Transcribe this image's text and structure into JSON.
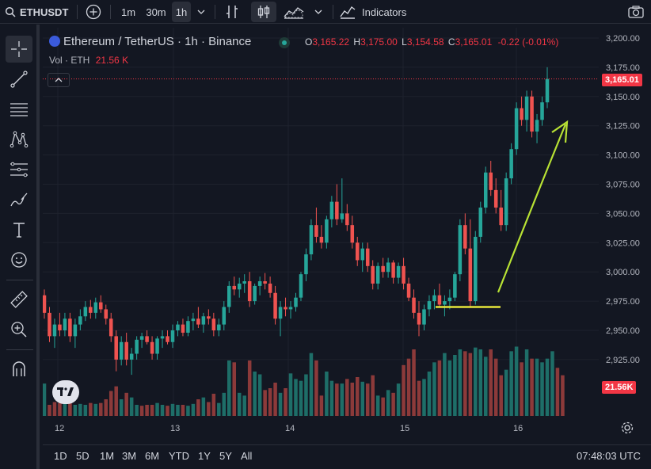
{
  "toolbar": {
    "symbol": "ETHUSDT",
    "intervals": [
      "1m",
      "30m",
      "1h"
    ],
    "active_interval": "1h",
    "indicators_label": "Indicators"
  },
  "legend": {
    "title": "Ethereum / TetherUS · 1h · Binance",
    "o_label": "O",
    "o_value": "3,165.22",
    "h_label": "H",
    "h_value": "3,175.00",
    "l_label": "L",
    "l_value": "3,154.58",
    "c_label": "C",
    "c_value": "3,165.01",
    "change": "-0.22 (-0.01%)",
    "vol_label": "Vol · ETH",
    "vol_value": "21.56 K"
  },
  "price_scale": {
    "ticks": [
      "3,200.00",
      "3,175.00",
      "3,150.00",
      "3,125.00",
      "3,100.00",
      "3,075.00",
      "3,050.00",
      "3,025.00",
      "3,000.00",
      "2,975.00",
      "2,950.00",
      "2,925.00"
    ],
    "last_price_badge": "3,165.01",
    "volume_badge": "21.56K"
  },
  "time_scale": {
    "labels": [
      "12",
      "13",
      "14",
      "15",
      "16"
    ]
  },
  "bottom": {
    "ranges": [
      "1D",
      "5D",
      "1M",
      "3M",
      "6M",
      "YTD",
      "1Y",
      "5Y",
      "All"
    ],
    "clock": "07:48:03 UTC"
  },
  "colors": {
    "up": "#26a69a",
    "down": "#ef5350",
    "up_volume": "#1e6e68",
    "down_volume": "#8c3a3a",
    "background": "#131722",
    "annotation_line": "#e6e63a",
    "annotation_arrow": "#b8e234"
  },
  "chart_data": {
    "type": "candlestick",
    "symbol": "ETHUSDT",
    "ylim": [
      2910,
      3210
    ],
    "candles": [
      [
        2980,
        2985,
        2960,
        2965
      ],
      [
        2965,
        2970,
        2940,
        2945
      ],
      [
        2945,
        2960,
        2935,
        2955
      ],
      [
        2955,
        2965,
        2945,
        2950
      ],
      [
        2950,
        2965,
        2945,
        2960
      ],
      [
        2960,
        2965,
        2940,
        2945
      ],
      [
        2945,
        2960,
        2935,
        2955
      ],
      [
        2955,
        2968,
        2950,
        2962
      ],
      [
        2962,
        2975,
        2958,
        2970
      ],
      [
        2970,
        2976,
        2960,
        2965
      ],
      [
        2965,
        2978,
        2960,
        2974
      ],
      [
        2974,
        2980,
        2965,
        2968
      ],
      [
        2968,
        2972,
        2955,
        2960
      ],
      [
        2960,
        2965,
        2940,
        2945
      ],
      [
        2945,
        2950,
        2915,
        2925
      ],
      [
        2925,
        2945,
        2920,
        2940
      ],
      [
        2940,
        2948,
        2920,
        2925
      ],
      [
        2925,
        2935,
        2912,
        2930
      ],
      [
        2930,
        2945,
        2925,
        2942
      ],
      [
        2942,
        2948,
        2935,
        2945
      ],
      [
        2945,
        2950,
        2938,
        2940
      ],
      [
        2940,
        2945,
        2925,
        2930
      ],
      [
        2930,
        2945,
        2925,
        2943
      ],
      [
        2943,
        2950,
        2935,
        2945
      ],
      [
        2945,
        2950,
        2938,
        2940
      ],
      [
        2940,
        2955,
        2935,
        2950
      ],
      [
        2950,
        2958,
        2945,
        2955
      ],
      [
        2955,
        2960,
        2945,
        2948
      ],
      [
        2948,
        2962,
        2945,
        2958
      ],
      [
        2958,
        2965,
        2950,
        2960
      ],
      [
        2960,
        2970,
        2952,
        2955
      ],
      [
        2955,
        2965,
        2948,
        2962
      ],
      [
        2962,
        2968,
        2955,
        2960
      ],
      [
        2960,
        2965,
        2945,
        2950
      ],
      [
        2950,
        2960,
        2945,
        2955
      ],
      [
        2955,
        2975,
        2950,
        2970
      ],
      [
        2970,
        2992,
        2965,
        2988
      ],
      [
        2988,
        2996,
        2980,
        2985
      ],
      [
        2985,
        2995,
        2978,
        2990
      ],
      [
        2990,
        2998,
        2982,
        2992
      ],
      [
        2992,
        3000,
        2970,
        2975
      ],
      [
        2975,
        2990,
        2972,
        2988
      ],
      [
        2988,
        2996,
        2980,
        2992
      ],
      [
        2992,
        2999,
        2985,
        2990
      ],
      [
        2990,
        2996,
        2978,
        2982
      ],
      [
        2982,
        2988,
        2955,
        2960
      ],
      [
        2960,
        2975,
        2945,
        2970
      ],
      [
        2970,
        2978,
        2962,
        2968
      ],
      [
        2968,
        2975,
        2960,
        2970
      ],
      [
        2970,
        2982,
        2966,
        2978
      ],
      [
        2978,
        3000,
        2975,
        2998
      ],
      [
        2998,
        3020,
        2992,
        3015
      ],
      [
        3015,
        3045,
        3010,
        3040
      ],
      [
        3040,
        3055,
        3025,
        3030
      ],
      [
        3030,
        3040,
        3020,
        3025
      ],
      [
        3025,
        3048,
        3020,
        3045
      ],
      [
        3045,
        3065,
        3038,
        3060
      ],
      [
        3060,
        3075,
        3040,
        3045
      ],
      [
        3045,
        3080,
        3042,
        3050
      ],
      [
        3050,
        3058,
        3035,
        3040
      ],
      [
        3040,
        3048,
        3020,
        3025
      ],
      [
        3025,
        3030,
        3005,
        3010
      ],
      [
        3010,
        3025,
        3000,
        3020
      ],
      [
        3020,
        3025,
        3000,
        3005
      ],
      [
        3005,
        3010,
        2985,
        2990
      ],
      [
        2990,
        3008,
        2985,
        3005
      ],
      [
        3005,
        3012,
        2995,
        3000
      ],
      [
        3000,
        3012,
        2995,
        3008
      ],
      [
        3008,
        3010,
        2990,
        2995
      ],
      [
        2995,
        3008,
        2990,
        3005
      ],
      [
        3005,
        3012,
        2985,
        2990
      ],
      [
        2990,
        2995,
        2975,
        2978
      ],
      [
        2978,
        2985,
        2960,
        2965
      ],
      [
        2965,
        2975,
        2945,
        2955
      ],
      [
        2955,
        2972,
        2950,
        2968
      ],
      [
        2968,
        2980,
        2962,
        2975
      ],
      [
        2975,
        2985,
        2968,
        2980
      ],
      [
        2980,
        2990,
        2970,
        2972
      ],
      [
        2972,
        2980,
        2962,
        2975
      ],
      [
        2975,
        2985,
        2968,
        2978
      ],
      [
        2978,
        3000,
        2975,
        2998
      ],
      [
        2998,
        3045,
        2992,
        3040
      ],
      [
        3040,
        3050,
        3015,
        3020
      ],
      [
        3020,
        3045,
        2970,
        2975
      ],
      [
        2975,
        3035,
        2972,
        3030
      ],
      [
        3030,
        3060,
        3025,
        3055
      ],
      [
        3055,
        3090,
        3050,
        3085
      ],
      [
        3085,
        3095,
        3065,
        3070
      ],
      [
        3070,
        3080,
        3050,
        3055
      ],
      [
        3055,
        3070,
        3035,
        3040
      ],
      [
        3040,
        3085,
        3035,
        3080
      ],
      [
        3080,
        3110,
        3075,
        3105
      ],
      [
        3105,
        3145,
        3100,
        3140
      ],
      [
        3140,
        3150,
        3125,
        3130
      ],
      [
        3130,
        3155,
        3120,
        3150
      ],
      [
        3150,
        3155,
        3115,
        3120
      ],
      [
        3120,
        3135,
        3110,
        3130
      ],
      [
        3130,
        3150,
        3125,
        3145
      ],
      [
        3145,
        3175,
        3140,
        3165
      ]
    ],
    "volume": [
      35,
      12,
      15,
      14,
      14,
      16,
      12,
      13,
      12,
      14,
      13,
      14,
      18,
      27,
      32,
      18,
      25,
      20,
      12,
      11,
      12,
      12,
      14,
      12,
      11,
      13,
      12,
      12,
      11,
      13,
      18,
      20,
      15,
      24,
      14,
      25,
      60,
      58,
      25,
      22,
      60,
      48,
      45,
      28,
      30,
      36,
      25,
      30,
      46,
      40,
      38,
      45,
      68,
      60,
      22,
      48,
      38,
      35,
      35,
      40,
      36,
      42,
      37,
      35,
      44,
      22,
      20,
      28,
      25,
      35,
      55,
      62,
      72,
      38,
      40,
      48,
      58,
      60,
      68,
      60,
      66,
      72,
      70,
      68,
      74,
      72,
      64,
      72,
      62,
      44,
      50,
      70,
      75,
      58,
      72,
      62,
      62,
      58,
      62,
      70,
      52,
      44
    ],
    "volume_flags": [
      0,
      1,
      1,
      1,
      0,
      1,
      0,
      0,
      0,
      1,
      0,
      1,
      1,
      1,
      1,
      0,
      1,
      0,
      0,
      1,
      1,
      1,
      0,
      0,
      1,
      0,
      0,
      1,
      0,
      0,
      1,
      0,
      1,
      1,
      0,
      0,
      0,
      1,
      0,
      0,
      1,
      0,
      0,
      1,
      1,
      1,
      0,
      1,
      0,
      0,
      0,
      0,
      0,
      1,
      1,
      0,
      0,
      1,
      0,
      1,
      1,
      1,
      0,
      1,
      1,
      0,
      1,
      0,
      1,
      0,
      1,
      1,
      1,
      1,
      0,
      0,
      0,
      1,
      0,
      0,
      0,
      0,
      1,
      1,
      0,
      0,
      0,
      1,
      1,
      1,
      0,
      0,
      0,
      1,
      0,
      1,
      0,
      0,
      0,
      0,
      1,
      1
    ]
  }
}
